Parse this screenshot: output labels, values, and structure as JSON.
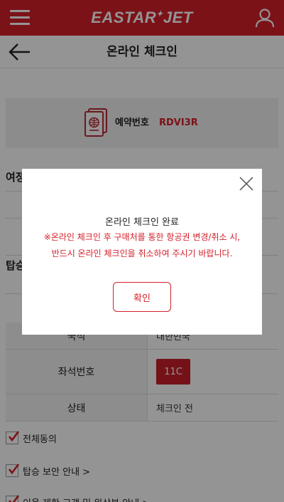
{
  "app": {
    "logo_text": "EASTAR",
    "logo_star": "✦",
    "logo_text2": "JET"
  },
  "header": {
    "title": "온라인 체크인"
  },
  "booking": {
    "label": "예약번호",
    "code": "RDVI3R"
  },
  "fragments": {
    "section1": "여정",
    "section2": "탑승"
  },
  "table": {
    "rows": [
      {
        "label": "국적",
        "value": "대한민국"
      },
      {
        "label": "좌석번호",
        "value": "11C"
      },
      {
        "label": "상태",
        "value": "체크인 전"
      }
    ]
  },
  "checks": [
    {
      "label": "전체동의",
      "checked": true
    },
    {
      "label": "탑승 보안 안내 >",
      "checked": true
    },
    {
      "label": "이용 제한 고객 및 위상분 안내 >",
      "checked": true
    }
  ],
  "modal": {
    "title": "온라인 체크인 완료",
    "warning_line1": "※온라인 체크인 후 구매처를 통한 항공권 변경/취소 시,",
    "warning_line2": "반드시 온라인 체크인을 취소하여 주시기 바랍니다.",
    "confirm_label": "확인"
  },
  "colors": {
    "brand": "#d5202a",
    "overlay": "rgba(0,0,0,0.42)"
  }
}
